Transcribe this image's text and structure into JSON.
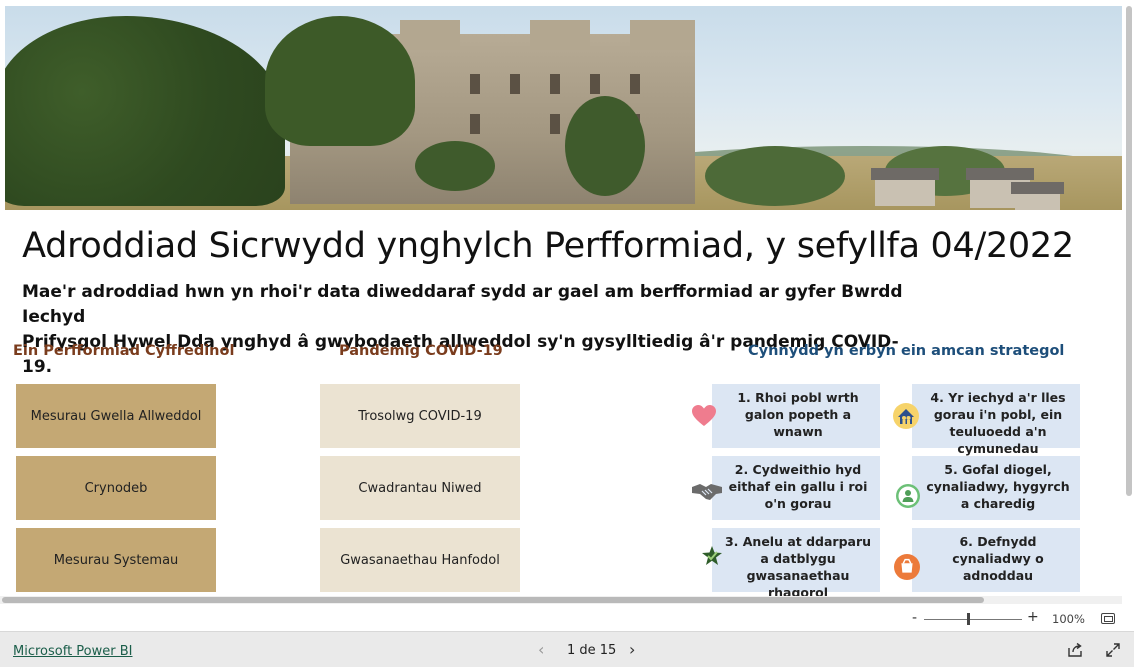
{
  "report": {
    "title": "Adroddiad Sicrwydd ynghylch Perfformiad, y sefyllfa 04/2022",
    "intro_line1": "Mae'r adroddiad hwn yn rhoi'r data diweddaraf sydd ar gael am berfformiad ar gyfer Bwrdd Iechyd",
    "intro_line2": "Prifysgol Hywel Dda ynghyd â gwybodaeth allweddol sy'n gysylltiedig â'r pandemig COVID-19."
  },
  "sections": {
    "performance": {
      "heading": "Ein Perfformiad Cyffredinol",
      "buttons": [
        "Mesurau Gwella Allweddol",
        "Crynodeb",
        "Mesurau Systemau"
      ]
    },
    "covid": {
      "heading": "Pandemig COVID-19",
      "buttons": [
        "Trosolwg COVID-19",
        "Cwadrantau Niwed",
        "Gwasanaethau Hanfodol"
      ]
    },
    "strategic": {
      "heading": "Cynnydd yn erbyn ein amcan strategol",
      "objectives": [
        {
          "label": "1. Rhoi pobl wrth galon popeth a wnawn",
          "icon": "heart-icon"
        },
        {
          "label": "2. Cydweithio hyd eithaf ein gallu i roi o'n gorau",
          "icon": "handshake-icon"
        },
        {
          "label": "3. Anelu at ddarparu a datblygu gwasanaethau rhagorol",
          "icon": "star-check-icon"
        },
        {
          "label": "4. Yr iechyd a'r lles gorau i'n pobl, ein teuluoedd a'n cymunedau",
          "icon": "community-icon"
        },
        {
          "label": "5. Gofal diogel, cynaliadwy, hygyrch a charedig",
          "icon": "person-icon"
        },
        {
          "label": "6. Defnydd cynaliadwy o adnoddau",
          "icon": "resources-icon"
        }
      ]
    }
  },
  "viewer": {
    "zoom_minus": "-",
    "zoom_plus": "+",
    "zoom_level": "100%",
    "zoom_fraction": 0.45,
    "brand_link": "Microsoft Power BI",
    "page_indicator": "1 de 15",
    "prev_glyph": "‹",
    "next_glyph": "›"
  },
  "colors": {
    "performance_button": "#c4a874",
    "covid_button": "#ebe3d2",
    "objective_card": "#dce6f3",
    "heading_brown": "#7a3c1d",
    "heading_blue": "#1d4e7a"
  }
}
